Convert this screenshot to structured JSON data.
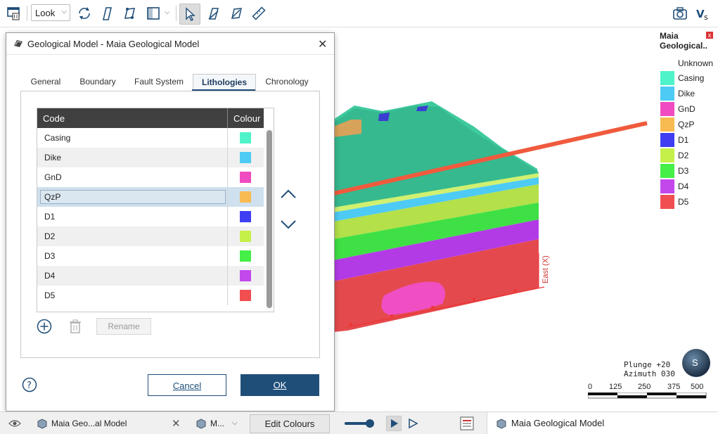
{
  "toolbar": {
    "look_label": "Look",
    "icons": [
      "trash-list-icon",
      "rotate-icon",
      "slice-icon",
      "move-plane-icon",
      "box-split-icon",
      "select-cursor-icon",
      "draw-line-icon",
      "measure-plane-icon",
      "ruler-icon",
      "camera-icon",
      "v-s-icon"
    ]
  },
  "legend": {
    "title_line1": "Maia",
    "title_line2": "Geological..",
    "close": "x",
    "unknown": "Unknown",
    "items": [
      {
        "label": "Casing",
        "color": "#4ff3c9"
      },
      {
        "label": "Dike",
        "color": "#4dcbf4"
      },
      {
        "label": "GnD",
        "color": "#f04bc0"
      },
      {
        "label": "QzP",
        "color": "#f7bb52"
      },
      {
        "label": "D1",
        "color": "#3f3ef2"
      },
      {
        "label": "D2",
        "color": "#c5f04a"
      },
      {
        "label": "D3",
        "color": "#45ef48"
      },
      {
        "label": "D4",
        "color": "#c348ec"
      },
      {
        "label": "D5",
        "color": "#f04e51"
      }
    ]
  },
  "axis_label": "East (X)",
  "nav": {
    "plunge": "Plunge +20",
    "azimuth": "Azimuth 030",
    "globe_letter": "S"
  },
  "scale": {
    "ticks": [
      "0",
      "125",
      "250",
      "375",
      "500"
    ]
  },
  "dialog": {
    "title": "Geological Model - Maia Geological Model",
    "tabs": [
      {
        "label": "General"
      },
      {
        "label": "Boundary"
      },
      {
        "label": "Fault System"
      },
      {
        "label": "Lithologies"
      },
      {
        "label": "Chronology"
      }
    ],
    "active_tab": "Lithologies",
    "table": {
      "headers": {
        "code": "Code",
        "colour": "Colour"
      },
      "rows": [
        {
          "code": "Casing",
          "color": "#4ff3c9"
        },
        {
          "code": "Dike",
          "color": "#4dcbf4"
        },
        {
          "code": "GnD",
          "color": "#f04bc0"
        },
        {
          "code": "QzP",
          "color": "#f7bb52"
        },
        {
          "code": "D1",
          "color": "#3f3ef2"
        },
        {
          "code": "D2",
          "color": "#c5f04a"
        },
        {
          "code": "D3",
          "color": "#45ef48"
        },
        {
          "code": "D4",
          "color": "#c348ec"
        },
        {
          "code": "D5",
          "color": "#f04e51"
        }
      ],
      "selected_row": "QzP"
    },
    "rename_label": "Rename",
    "cancel_label": "Cancel",
    "ok_label": "OK"
  },
  "statusbar": {
    "tab1": "Maia Geo...al Model",
    "tab2": "M...",
    "edit_colours": "Edit Colours",
    "right_title": "Maia Geological Model"
  }
}
